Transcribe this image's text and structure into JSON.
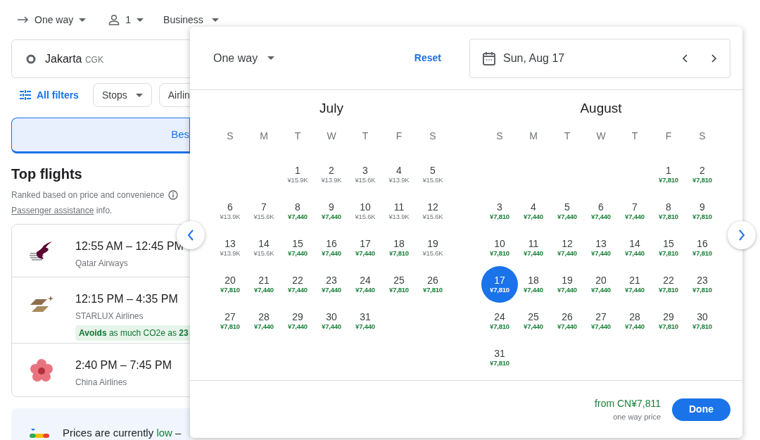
{
  "top_bar": {
    "trip_type": "One way",
    "passengers": "1",
    "cabin": "Business"
  },
  "origin": {
    "city": "Jakarta",
    "code": "CGK"
  },
  "filters": {
    "all_filters": "All filters",
    "chips": [
      {
        "label": "Stops",
        "dropdown": true
      },
      {
        "label": "Airlin",
        "dropdown": false
      }
    ]
  },
  "sort_tabs": [
    {
      "label": "Bes",
      "selected": true
    }
  ],
  "top_flights": {
    "title": "Top flights",
    "subtitle": "Ranked based on price and convenience",
    "assistance_link": "Passenger assistance",
    "assistance_suffix": "info."
  },
  "flights": [
    {
      "times": "12:55 AM – 12:45 PM",
      "airline": "Qatar Airways",
      "kind": "bird"
    },
    {
      "times": "12:15 PM – 4:35 PM",
      "airline": "STARLUX Airlines",
      "kind": "star",
      "eco_badge": "**Avoids** as much CO2e as **23**"
    },
    {
      "times": "2:40 PM – 7:45 PM",
      "airline": "China Airlines",
      "kind": "flower"
    }
  ],
  "price_insight": {
    "lead": "Prices are currently",
    "level_word": "low",
    "trail": "–"
  },
  "date_dialog": {
    "trip_type": "One way",
    "reset": "Reset",
    "date": "Sun, Aug 17",
    "months": [
      {
        "name": "July",
        "weekdays": [
          "S",
          "M",
          "T",
          "W",
          "T",
          "F",
          "S"
        ],
        "weeks": [
          {
            "kind": "right",
            "days": [
              {
                "day": "1",
                "price": "¥15.9K",
                "cheap": false,
                "selected": false
              },
              {
                "day": "2",
                "price": "¥13.9K",
                "cheap": false,
                "selected": false
              },
              {
                "day": "3",
                "price": "¥15.6K",
                "cheap": false,
                "selected": false
              },
              {
                "day": "4",
                "price": "¥13.9K",
                "cheap": false,
                "selected": false
              },
              {
                "day": "5",
                "price": "¥15.6K",
                "cheap": false,
                "selected": false
              }
            ]
          },
          {
            "kind": "left",
            "days": [
              {
                "day": "6",
                "price": "¥13.9K",
                "cheap": false,
                "selected": false
              },
              {
                "day": "7",
                "price": "¥15.6K",
                "cheap": false,
                "selected": false
              },
              {
                "day": "8",
                "price": "¥7,440",
                "cheap": true,
                "selected": false
              },
              {
                "day": "9",
                "price": "¥7,440",
                "cheap": true,
                "selected": false
              },
              {
                "day": "10",
                "price": "¥15.6K",
                "cheap": false,
                "selected": false
              },
              {
                "day": "11",
                "price": "¥13.9K",
                "cheap": false,
                "selected": false
              },
              {
                "day": "12",
                "price": "¥15.6K",
                "cheap": false,
                "selected": false
              }
            ]
          },
          {
            "kind": "left",
            "days": [
              {
                "day": "13",
                "price": "¥13.9K",
                "cheap": false,
                "selected": false
              },
              {
                "day": "14",
                "price": "¥15.6K",
                "cheap": false,
                "selected": false
              },
              {
                "day": "15",
                "price": "¥7,440",
                "cheap": true,
                "selected": false
              },
              {
                "day": "16",
                "price": "¥7,440",
                "cheap": true,
                "selected": false
              },
              {
                "day": "17",
                "price": "¥7,440",
                "cheap": true,
                "selected": false
              },
              {
                "day": "18",
                "price": "¥7,810",
                "cheap": true,
                "selected": false
              },
              {
                "day": "19",
                "price": "¥15.6K",
                "cheap": false,
                "selected": false
              }
            ]
          },
          {
            "kind": "left",
            "days": [
              {
                "day": "20",
                "price": "¥7,810",
                "cheap": true,
                "selected": false
              },
              {
                "day": "21",
                "price": "¥7,440",
                "cheap": true,
                "selected": false
              },
              {
                "day": "22",
                "price": "¥7,440",
                "cheap": true,
                "selected": false
              },
              {
                "day": "23",
                "price": "¥7,440",
                "cheap": true,
                "selected": false
              },
              {
                "day": "24",
                "price": "¥7,440",
                "cheap": true,
                "selected": false
              },
              {
                "day": "25",
                "price": "¥7,810",
                "cheap": true,
                "selected": false
              },
              {
                "day": "26",
                "price": "¥7,810",
                "cheap": true,
                "selected": false
              }
            ]
          },
          {
            "kind": "left",
            "days": [
              {
                "day": "27",
                "price": "¥7,810",
                "cheap": true,
                "selected": false
              },
              {
                "day": "28",
                "price": "¥7,440",
                "cheap": true,
                "selected": false
              },
              {
                "day": "29",
                "price": "¥7,440",
                "cheap": true,
                "selected": false
              },
              {
                "day": "30",
                "price": "¥7,440",
                "cheap": true,
                "selected": false
              },
              {
                "day": "31",
                "price": "¥7,440",
                "cheap": true,
                "selected": false
              }
            ]
          }
        ]
      },
      {
        "name": "August",
        "weekdays": [
          "S",
          "M",
          "T",
          "W",
          "T",
          "F",
          "S"
        ],
        "weeks": [
          {
            "kind": "right",
            "days": [
              {
                "day": "1",
                "price": "¥7,810",
                "cheap": true,
                "selected": false
              },
              {
                "day": "2",
                "price": "¥7,810",
                "cheap": true,
                "selected": false
              }
            ]
          },
          {
            "kind": "left",
            "days": [
              {
                "day": "3",
                "price": "¥7,810",
                "cheap": true,
                "selected": false
              },
              {
                "day": "4",
                "price": "¥7,440",
                "cheap": true,
                "selected": false
              },
              {
                "day": "5",
                "price": "¥7,440",
                "cheap": true,
                "selected": false
              },
              {
                "day": "6",
                "price": "¥7,440",
                "cheap": true,
                "selected": false
              },
              {
                "day": "7",
                "price": "¥7,440",
                "cheap": true,
                "selected": false
              },
              {
                "day": "8",
                "price": "¥7,810",
                "cheap": true,
                "selected": false
              },
              {
                "day": "9",
                "price": "¥7,810",
                "cheap": true,
                "selected": false
              }
            ]
          },
          {
            "kind": "left",
            "days": [
              {
                "day": "10",
                "price": "¥7,810",
                "cheap": true,
                "selected": false
              },
              {
                "day": "11",
                "price": "¥7,440",
                "cheap": true,
                "selected": false
              },
              {
                "day": "12",
                "price": "¥7,440",
                "cheap": true,
                "selected": false
              },
              {
                "day": "13",
                "price": "¥7,440",
                "cheap": true,
                "selected": false
              },
              {
                "day": "14",
                "price": "¥7,440",
                "cheap": true,
                "selected": false
              },
              {
                "day": "15",
                "price": "¥7,810",
                "cheap": true,
                "selected": false
              },
              {
                "day": "16",
                "price": "¥7,810",
                "cheap": true,
                "selected": false
              }
            ]
          },
          {
            "kind": "left",
            "days": [
              {
                "day": "17",
                "price": "¥7,810",
                "cheap": true,
                "selected": true
              },
              {
                "day": "18",
                "price": "¥7,440",
                "cheap": true,
                "selected": false
              },
              {
                "day": "19",
                "price": "¥7,440",
                "cheap": true,
                "selected": false
              },
              {
                "day": "20",
                "price": "¥7,440",
                "cheap": true,
                "selected": false
              },
              {
                "day": "21",
                "price": "¥7,440",
                "cheap": true,
                "selected": false
              },
              {
                "day": "22",
                "price": "¥7,810",
                "cheap": true,
                "selected": false
              },
              {
                "day": "23",
                "price": "¥7,810",
                "cheap": true,
                "selected": false
              }
            ]
          },
          {
            "kind": "left",
            "days": [
              {
                "day": "24",
                "price": "¥7,810",
                "cheap": true,
                "selected": false
              },
              {
                "day": "25",
                "price": "¥7,440",
                "cheap": true,
                "selected": false
              },
              {
                "day": "26",
                "price": "¥7,440",
                "cheap": true,
                "selected": false
              },
              {
                "day": "27",
                "price": "¥7,440",
                "cheap": true,
                "selected": false
              },
              {
                "day": "28",
                "price": "¥7,440",
                "cheap": true,
                "selected": false
              },
              {
                "day": "29",
                "price": "¥7,810",
                "cheap": true,
                "selected": false
              },
              {
                "day": "30",
                "price": "¥7,810",
                "cheap": true,
                "selected": false
              }
            ]
          },
          {
            "kind": "left",
            "days": [
              {
                "day": "31",
                "price": "¥7,810",
                "cheap": true,
                "selected": false
              }
            ]
          }
        ]
      }
    ],
    "footer": {
      "price": "from CN¥7,811",
      "note": "one way price",
      "done": "Done"
    }
  }
}
